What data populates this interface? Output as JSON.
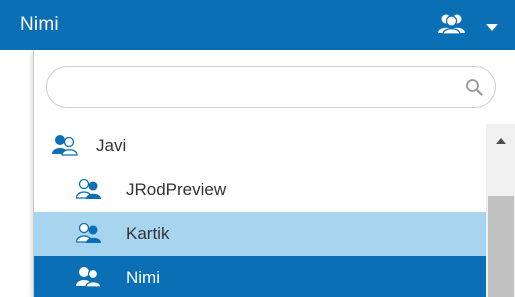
{
  "header": {
    "title": "Nimi",
    "users_icon": "users-group-icon",
    "caret_icon": "caret-down-icon"
  },
  "search": {
    "placeholder": "",
    "value": "",
    "icon": "search-icon"
  },
  "list": {
    "items": [
      {
        "label": "Javi",
        "icon": "user-group-icon",
        "state": "normal"
      },
      {
        "label": "JRodPreview",
        "icon": "user-group-outline-icon",
        "state": "normal"
      },
      {
        "label": "Kartik",
        "icon": "user-group-outline-icon",
        "state": "hover"
      },
      {
        "label": "Nimi",
        "icon": "user-group-icon",
        "state": "selected"
      }
    ]
  },
  "colors": {
    "brand": "#0a6fb5",
    "hover": "#a7d4ef",
    "text": "#333333",
    "scrollbar_thumb": "#c1c1c1"
  }
}
